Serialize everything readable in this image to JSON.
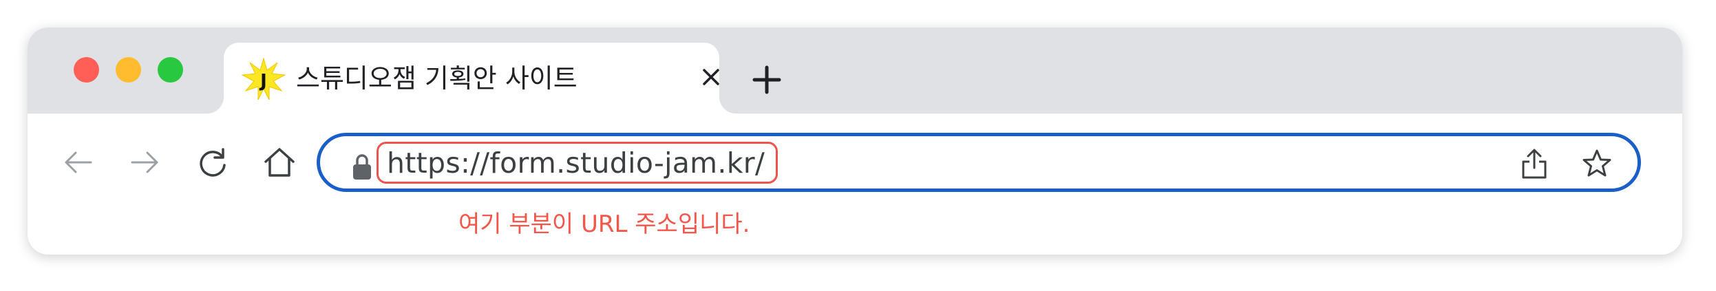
{
  "window": {
    "traffic_lights": [
      "close",
      "minimize",
      "maximize"
    ]
  },
  "tab": {
    "favicon_letter": "J",
    "title": "스튜디오잼 기획안 사이트",
    "close_icon": "close-icon"
  },
  "toolbar": {
    "back_icon": "arrow-left-icon",
    "forward_icon": "arrow-right-icon",
    "reload_icon": "reload-icon",
    "home_icon": "home-icon",
    "new_tab_icon": "plus-icon"
  },
  "address_bar": {
    "url": "https://form.studio-jam.kr/",
    "lock_icon": "lock-icon",
    "share_icon": "share-icon",
    "bookmark_icon": "star-icon"
  },
  "annotation": {
    "text": "여기 부분이 URL 주소입니다."
  },
  "colors": {
    "accent_blue": "#1a5fc8",
    "annotation_red": "#f4564a",
    "tabstrip_gray": "#dfe1e5",
    "favicon_yellow": "#fde723"
  }
}
